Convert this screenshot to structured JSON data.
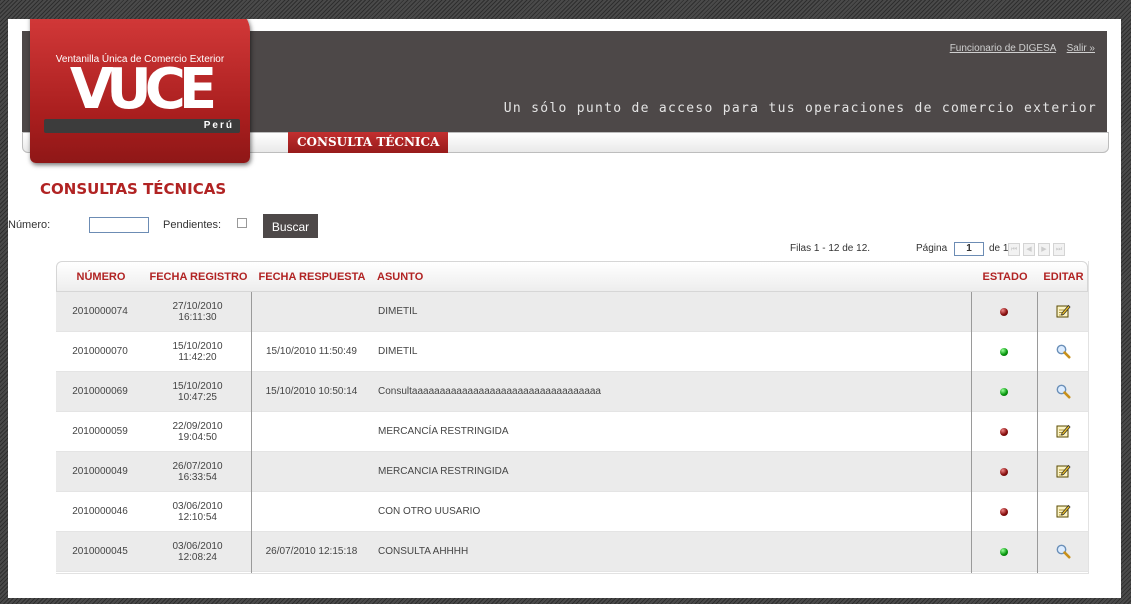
{
  "header": {
    "logo_subtitle": "Ventanilla Única de Comercio Exterior",
    "logo_text": "VUCE",
    "logo_country": "Perú",
    "user_link": "Funcionario de DIGESA",
    "logout_link": "Salir »",
    "tagline": "Un sólo punto de acceso para tus operaciones de comercio exterior"
  },
  "nav": {
    "active_tab": "CONSULTA TÉCNICA"
  },
  "page": {
    "title": "CONSULTAS TÉCNICAS"
  },
  "filters": {
    "numero_label": "Número:",
    "numero_value": "",
    "pendientes_label": "Pendientes:",
    "pendientes_checked": false,
    "search_button": "Buscar"
  },
  "pager": {
    "rows_text": "Filas 1 - 12 de 12.",
    "page_label": "Página",
    "current_page": "1",
    "of_text": "de 1"
  },
  "colors": {
    "accent": "#b12323",
    "header_bg": "#4d4848",
    "state_pending": "#8a1010",
    "state_answered": "#0a9a10"
  },
  "table": {
    "columns": [
      "NÚMERO",
      "FECHA REGISTRO",
      "FECHA RESPUESTA",
      "ASUNTO",
      "ESTADO",
      "EDITAR"
    ],
    "rows": [
      {
        "numero": "2010000074",
        "fecha_fecha": "27/10/2010",
        "fecha_hora": "16:11:30",
        "respuesta": "",
        "asunto": "DIMETIL",
        "estado": "red",
        "accion": "edit-icon"
      },
      {
        "numero": "2010000070",
        "fecha_fecha": "15/10/2010",
        "fecha_hora": "11:42:20",
        "respuesta": "15/10/2010 11:50:49",
        "asunto": "DIMETIL",
        "estado": "green",
        "accion": "magnifier-icon"
      },
      {
        "numero": "2010000069",
        "fecha_fecha": "15/10/2010",
        "fecha_hora": "10:47:25",
        "respuesta": "15/10/2010 10:50:14",
        "asunto": "Consultaaaaaaaaaaaaaaaaaaaaaaaaaaaaaaaaaa",
        "estado": "green",
        "accion": "magnifier-icon"
      },
      {
        "numero": "2010000059",
        "fecha_fecha": "22/09/2010",
        "fecha_hora": "19:04:50",
        "respuesta": "",
        "asunto": "MERCANCÍA RESTRINGIDA",
        "estado": "red",
        "accion": "edit-icon"
      },
      {
        "numero": "2010000049",
        "fecha_fecha": "26/07/2010",
        "fecha_hora": "16:33:54",
        "respuesta": "",
        "asunto": "MERCANCIA RESTRINGIDA",
        "estado": "red",
        "accion": "edit-icon"
      },
      {
        "numero": "2010000046",
        "fecha_fecha": "03/06/2010",
        "fecha_hora": "12:10:54",
        "respuesta": "",
        "asunto": "CON OTRO UUSARIO",
        "estado": "red",
        "accion": "edit-icon"
      },
      {
        "numero": "2010000045",
        "fecha_fecha": "03/06/2010",
        "fecha_hora": "12:08:24",
        "respuesta": "26/07/2010 12:15:18",
        "asunto": "CONSULTA AHHHH",
        "estado": "green",
        "accion": "magnifier-icon"
      }
    ]
  }
}
